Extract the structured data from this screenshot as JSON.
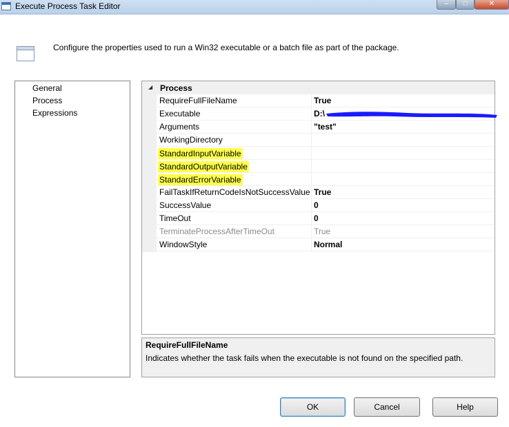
{
  "window": {
    "title": "Execute Process Task Editor",
    "close_glyph": "✕",
    "min_glyph": "–",
    "max_glyph": "□"
  },
  "header": {
    "description": "Configure the properties used to run a Win32 executable or a batch file as part of the package."
  },
  "nav": {
    "items": [
      {
        "label": "General"
      },
      {
        "label": "Process"
      },
      {
        "label": "Expressions"
      }
    ]
  },
  "grid": {
    "category": "Process",
    "rows": [
      {
        "name": "RequireFullFileName",
        "value": "True"
      },
      {
        "name": "Executable",
        "value": "D:\\"
      },
      {
        "name": "Arguments",
        "value": "\"test\""
      },
      {
        "name": "WorkingDirectory",
        "value": ""
      },
      {
        "name": "StandardInputVariable",
        "value": ""
      },
      {
        "name": "StandardOutputVariable",
        "value": ""
      },
      {
        "name": "StandardErrorVariable",
        "value": ""
      },
      {
        "name": "FailTaskIfReturnCodeIsNotSuccessValue",
        "value": "True"
      },
      {
        "name": "SuccessValue",
        "value": "0"
      },
      {
        "name": "TimeOut",
        "value": "0"
      },
      {
        "name": "TerminateProcessAfterTimeOut",
        "value": "True"
      },
      {
        "name": "WindowStyle",
        "value": "Normal"
      }
    ]
  },
  "description_panel": {
    "title": "RequireFullFileName",
    "text": "Indicates whether the task fails when the executable is not found on the specified path."
  },
  "buttons": {
    "ok": "OK",
    "cancel": "Cancel",
    "help": "Help"
  },
  "colors": {
    "highlight": "#ffff4a",
    "redaction": "#1a1aff"
  }
}
